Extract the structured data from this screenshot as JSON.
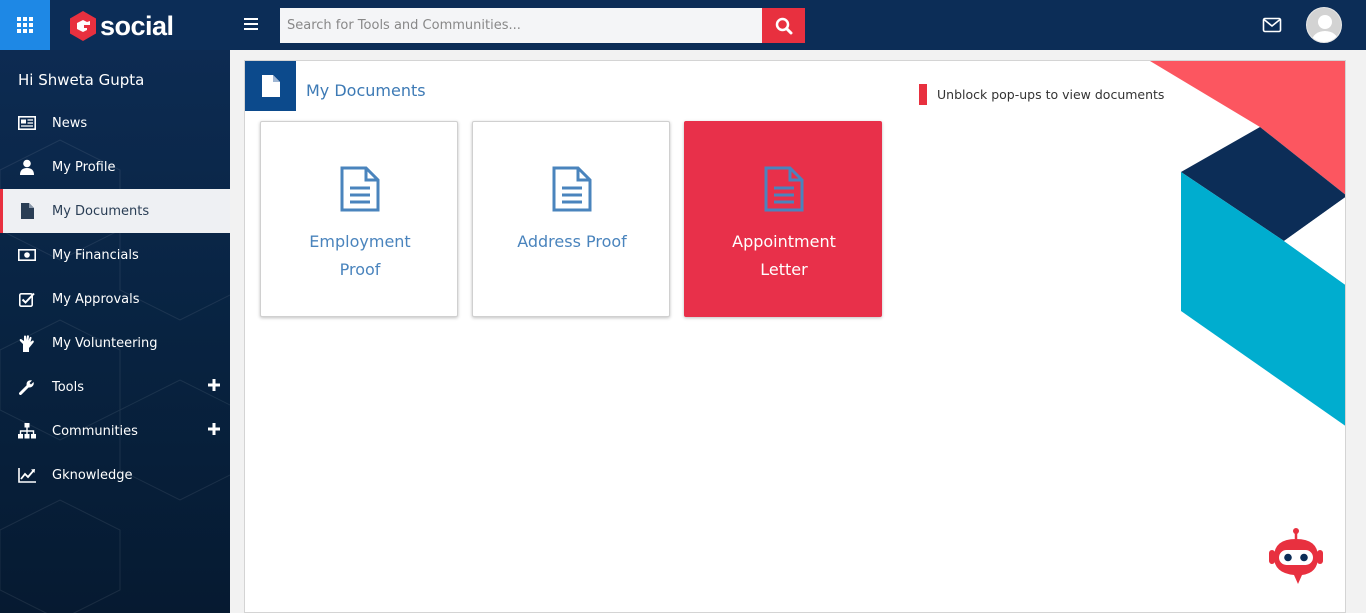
{
  "topbar": {
    "logo_text": "social",
    "search_placeholder": "Search for Tools and Communities..."
  },
  "sidebar": {
    "greeting": "Hi Shweta Gupta",
    "items": [
      {
        "label": "News"
      },
      {
        "label": "My Profile"
      },
      {
        "label": "My Documents"
      },
      {
        "label": "My Financials"
      },
      {
        "label": "My Approvals"
      },
      {
        "label": "My Volunteering"
      },
      {
        "label": "Tools"
      },
      {
        "label": "Communities"
      },
      {
        "label": "Gknowledge"
      }
    ]
  },
  "main": {
    "title": "My Documents",
    "notice": "Unblock pop-ups to view documents",
    "cards": [
      {
        "line1": "Employment",
        "line2": "Proof"
      },
      {
        "line1": "Address Proof",
        "line2": ""
      },
      {
        "line1": "Appointment",
        "line2": "Letter"
      }
    ]
  },
  "colors": {
    "topbar": "#0c2d57",
    "accent_red": "#e8303f",
    "apps_blue": "#1e88e5",
    "link_blue": "#4a84bd",
    "card_highlight": "#e8304a"
  },
  "icons": {
    "apps": "grid-icon",
    "menu": "hamburger-icon",
    "search": "search-icon",
    "mail": "envelope-icon",
    "user": "avatar-icon",
    "document": "document-icon",
    "chatbot": "robot-icon"
  }
}
